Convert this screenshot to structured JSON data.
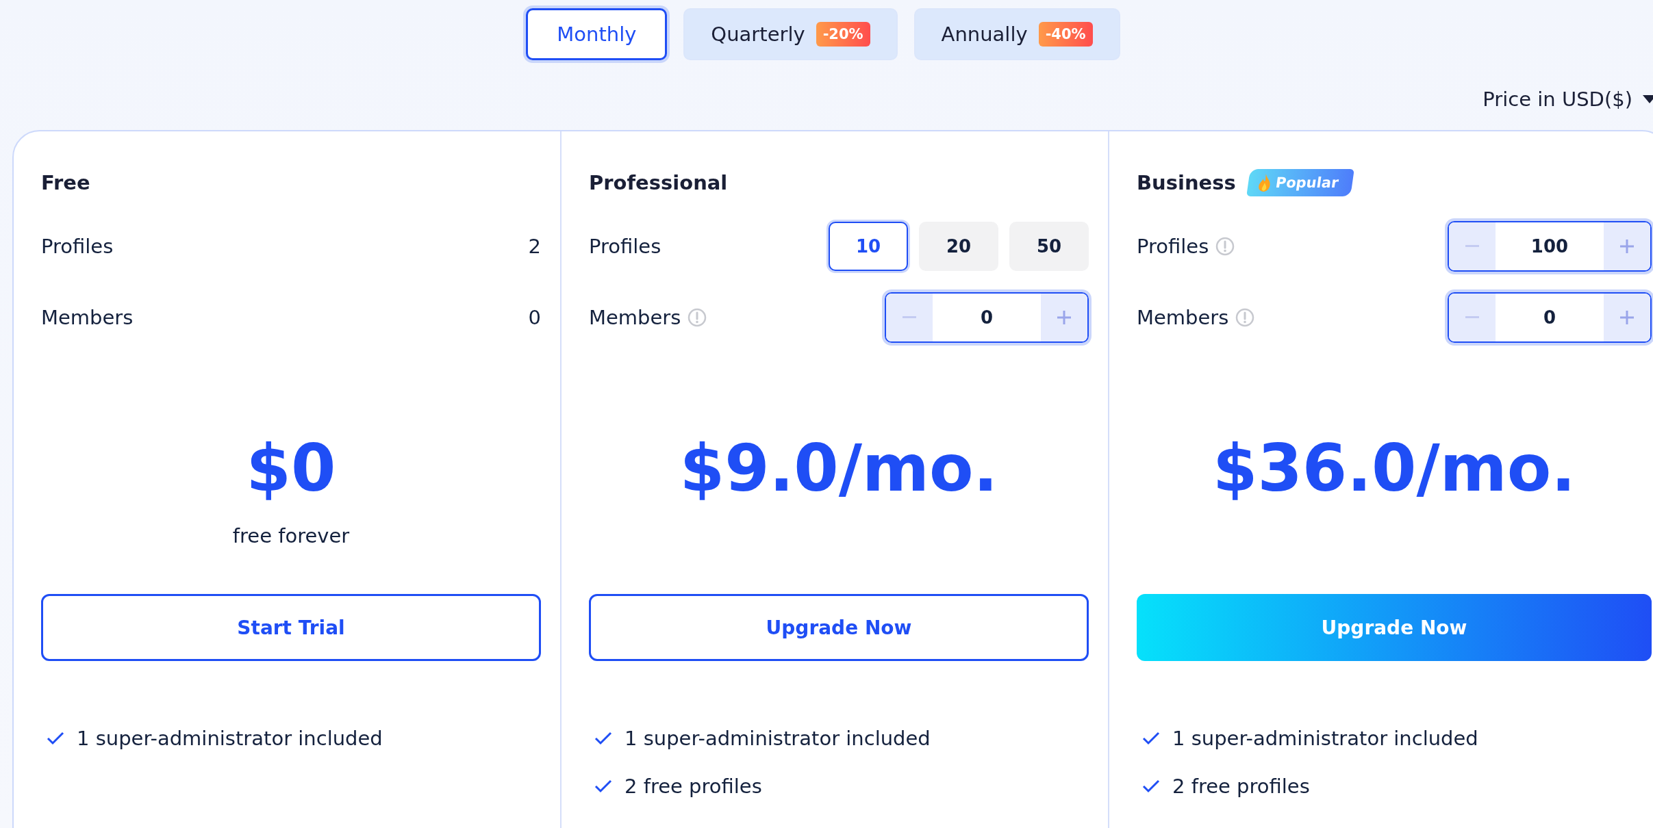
{
  "billing_periods": [
    {
      "label": "Monthly",
      "selected": true
    },
    {
      "label": "Quarterly",
      "discount": "-20%",
      "selected": false
    },
    {
      "label": "Annually",
      "discount": "-40%",
      "selected": false
    }
  ],
  "currency": {
    "label": "Price in USD($)"
  },
  "plans": [
    {
      "name": "Free",
      "rows": [
        {
          "kind": "value",
          "label": "Profiles",
          "info": false,
          "value": "2"
        },
        {
          "kind": "value",
          "label": "Members",
          "info": false,
          "value": "0"
        }
      ],
      "price": "$0",
      "price_note": "free forever",
      "button": {
        "label": "Start Trial",
        "kind": "outline"
      },
      "features": [
        "1 super-administrator included"
      ]
    },
    {
      "name": "Professional",
      "rows": [
        {
          "kind": "options",
          "label": "Profiles",
          "info": false,
          "options": [
            {
              "label": "10",
              "selected": true
            },
            {
              "label": "20",
              "selected": false
            },
            {
              "label": "50",
              "selected": false
            }
          ]
        },
        {
          "kind": "stepper",
          "label": "Members",
          "info": true,
          "value": "0"
        }
      ],
      "price": "$9.0/mo.",
      "button": {
        "label": "Upgrade Now",
        "kind": "outline"
      },
      "features": [
        "1 super-administrator included",
        "2 free profiles"
      ]
    },
    {
      "name": "Business",
      "badge": "Popular",
      "rows": [
        {
          "kind": "stepper",
          "label": "Profiles",
          "info": true,
          "value": "100"
        },
        {
          "kind": "stepper",
          "label": "Members",
          "info": true,
          "value": "0"
        }
      ],
      "price": "$36.0/mo.",
      "button": {
        "label": "Upgrade Now",
        "kind": "gradient"
      },
      "features": [
        "1 super-administrator included",
        "2 free profiles"
      ]
    }
  ]
}
